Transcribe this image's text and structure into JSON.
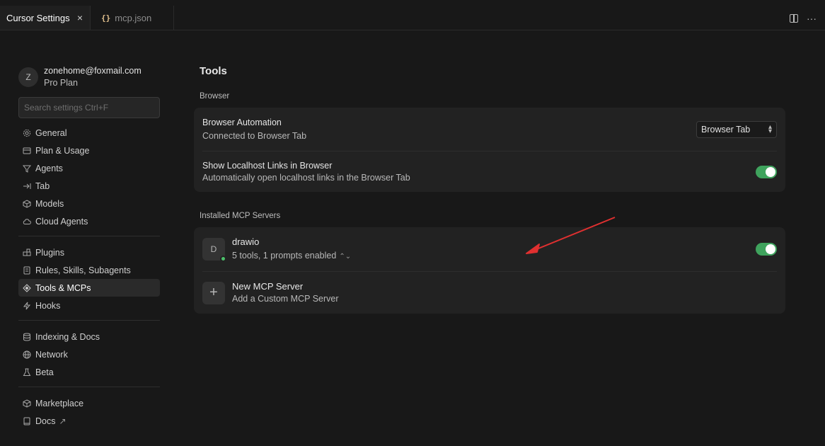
{
  "tabs": [
    {
      "label": "Cursor Settings",
      "close": "×",
      "active": true
    },
    {
      "label": "mcp.json",
      "icon": "{}",
      "active": false
    }
  ],
  "account": {
    "initial": "Z",
    "email": "zonehome@foxmail.com",
    "plan": "Pro Plan"
  },
  "search": {
    "placeholder": "Search settings Ctrl+F"
  },
  "sidebar": {
    "group1": [
      {
        "label": "General",
        "icon": "gear-icon"
      },
      {
        "label": "Plan & Usage",
        "icon": "card-icon"
      },
      {
        "label": "Agents",
        "icon": "funnel-icon"
      },
      {
        "label": "Tab",
        "icon": "tab-arrow-icon"
      },
      {
        "label": "Models",
        "icon": "cube-icon"
      },
      {
        "label": "Cloud Agents",
        "icon": "cloud-icon"
      }
    ],
    "group2": [
      {
        "label": "Plugins",
        "icon": "plugin-icon"
      },
      {
        "label": "Rules, Skills, Subagents",
        "icon": "document-icon"
      },
      {
        "label": "Tools & MCPs",
        "icon": "tools-icon",
        "active": true
      },
      {
        "label": "Hooks",
        "icon": "bolt-icon"
      }
    ],
    "group3": [
      {
        "label": "Indexing & Docs",
        "icon": "database-icon"
      },
      {
        "label": "Network",
        "icon": "globe-icon"
      },
      {
        "label": "Beta",
        "icon": "flask-icon"
      }
    ],
    "group4": [
      {
        "label": "Marketplace",
        "icon": "box-icon"
      },
      {
        "label": "Docs",
        "icon": "book-icon",
        "suffix": "↗"
      }
    ]
  },
  "main": {
    "title": "Tools",
    "browser_section": "Browser",
    "browser_automation": {
      "title": "Browser Automation",
      "subtitle": "Connected to Browser Tab",
      "select_value": "Browser Tab"
    },
    "localhost_links": {
      "title": "Show Localhost Links in Browser",
      "subtitle": "Automatically open localhost links in the Browser Tab",
      "enabled": true
    },
    "mcp_section": "Installed MCP Servers",
    "mcp_servers": [
      {
        "initial": "D",
        "name": "drawio",
        "summary": "5 tools, 1 prompts enabled",
        "enabled": true,
        "status": "connected"
      }
    ],
    "new_server": {
      "title": "New MCP Server",
      "subtitle": "Add a Custom MCP Server"
    }
  },
  "colors": {
    "background": "#181818",
    "card": "#222222",
    "toggle_on": "#3fa35d",
    "status_dot": "#4cc06a",
    "annotation_arrow": "#e03030"
  }
}
